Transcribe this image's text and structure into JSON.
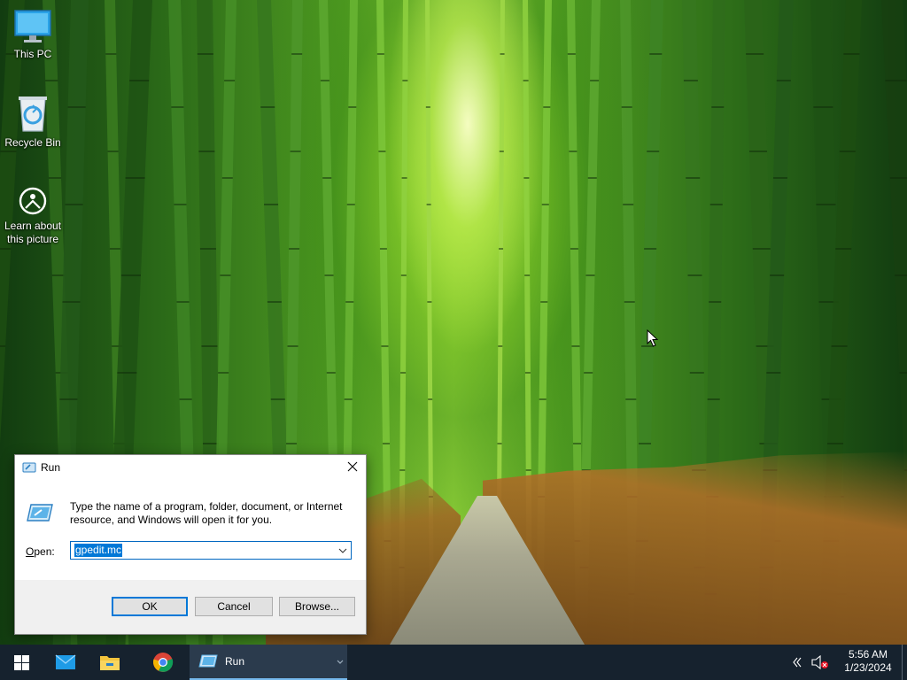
{
  "desktop": {
    "icons": [
      {
        "label": "This PC",
        "icon": "monitor-icon"
      },
      {
        "label": "Recycle Bin",
        "icon": "recycle-bin-icon"
      },
      {
        "label": "Learn about this picture",
        "icon": "camera-info-icon"
      }
    ]
  },
  "run_dialog": {
    "title": "Run",
    "description": "Type the name of a program, folder, document, or Internet resource, and Windows will open it for you.",
    "open_label": "Open:",
    "open_value": "gpedit.mc",
    "buttons": {
      "ok": "OK",
      "cancel": "Cancel",
      "browse": "Browse..."
    }
  },
  "taskbar": {
    "items": [
      {
        "name": "start",
        "icon": "windows-logo-icon"
      },
      {
        "name": "mail",
        "icon": "mail-icon"
      },
      {
        "name": "file-explorer",
        "icon": "folder-icon"
      },
      {
        "name": "chrome",
        "icon": "chrome-icon"
      }
    ],
    "run_label": "Run",
    "clock_time": "5:56 AM",
    "clock_date": "1/23/2024"
  },
  "colors": {
    "taskbar_bg": "#16222e",
    "accent": "#0078d7",
    "dialog_footer": "#f0f0f0"
  }
}
